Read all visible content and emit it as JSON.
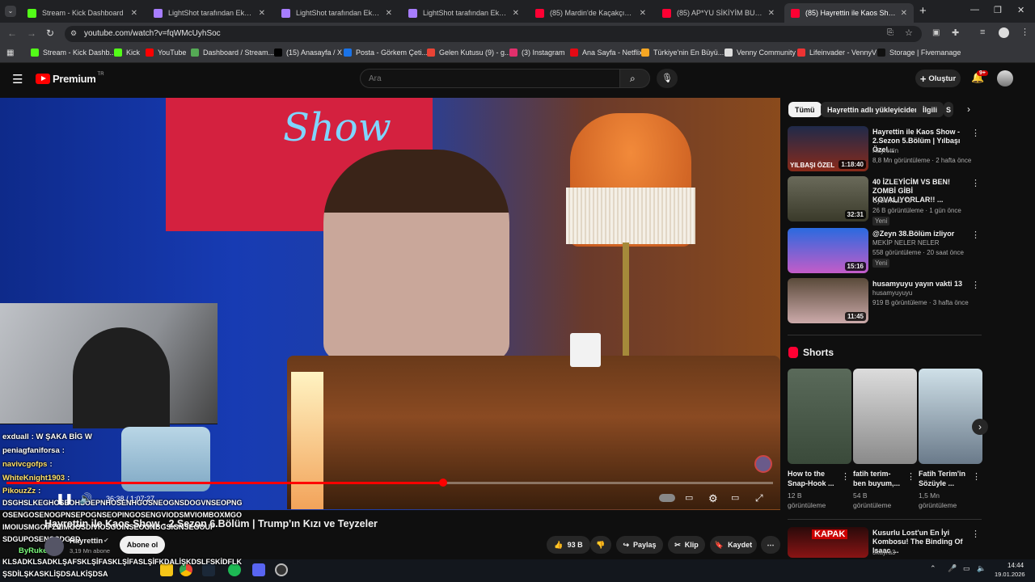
{
  "browser": {
    "tabs": [
      {
        "title": "Stream - Kick Dashboard",
        "color": "#53fc18"
      },
      {
        "title": "LightShot tarafından Ekran Gör",
        "color": "#a77dff"
      },
      {
        "title": "LightShot tarafından Ekran Gör",
        "color": "#a77dff"
      },
      {
        "title": "LightShot tarafından Ekran Gör",
        "color": "#a77dff"
      },
      {
        "title": "(85) Mardin'de Kaçakçıdan 3 D",
        "color": "#ff0033"
      },
      {
        "title": "(85) AP*YU SİKİYİM BU NASIL S",
        "color": "#ff0033"
      },
      {
        "title": "(85) Hayrettin ile Kaos Show",
        "color": "#ff0033"
      }
    ],
    "url": "youtube.com/watch?v=fqWMcUyhSoc",
    "bookmarks": [
      "Stream - Kick Dashb...",
      "Kick",
      "YouTube",
      "Dashboard / Stream...",
      "(15) Anasayfa / X",
      "Posta - Görkem Çeti...",
      "Gelen Kutusu (9) - g...",
      "(3) Instagram",
      "Ana Sayfa - Netflix",
      "Türkiye'nin En Büyü...",
      "Venny Community",
      "Lifeinvader - VennyV",
      "Storage | Fivemanage"
    ]
  },
  "youtube": {
    "logo": "Premium",
    "region": "TR",
    "search_placeholder": "Ara",
    "create_label": "Oluştur",
    "notif_count": "9+",
    "player": {
      "time": "36:38 / 1:07:27",
      "progress": 0.57,
      "scene_sign": "Show"
    },
    "video_title": "Hayrettin ile Kaos Show - 2.Sezon 6.Bölüm | Trump'ın Kızı ve Teyzeler",
    "channel": {
      "name": "Hayrettin",
      "subs": "3,19 Mn abone",
      "subscribe": "Abone ol"
    },
    "actions": {
      "likes": "93 B",
      "share": "Paylaş",
      "clip": "Klip",
      "save": "Kaydet"
    },
    "chips": [
      "Tümü",
      "Hayrettin adlı yükleyiciden",
      "İlgili",
      "S"
    ],
    "recommendations": [
      {
        "title": "Hayrettin ile Kaos Show - 2.Sezon 5.Bölüm | Yılbaşı Özel...",
        "channel": "Hayrettin",
        "meta": "8,8 Mn görüntüleme · 2 hafta önce",
        "duration": "1:18:40",
        "thumb_label": "YILBAŞI ÖZEL",
        "badge": ""
      },
      {
        "title": "40 İZLEYİCİM VS BEN! ZOMBİ GİBİ KOVALIYORLAR!! ...",
        "channel": "CyberRulz Tv",
        "meta": "26 B görüntüleme · 1 gün önce",
        "duration": "32:31",
        "thumb_label": "",
        "badge": "Yeni"
      },
      {
        "title": "@Zeyn 38.Bölüm izliyor",
        "channel": "MEKİP NELER NELER",
        "meta": "558 görüntüleme · 20 saat önce",
        "duration": "15:16",
        "thumb_label": "",
        "badge": "Yeni"
      },
      {
        "title": "husamyuyu yayın vakti 13",
        "channel": "husamyuyuyu",
        "meta": "919 B görüntüleme · 3 hafta önce",
        "duration": "11:45",
        "thumb_label": "",
        "badge": ""
      }
    ],
    "shorts_heading": "Shorts",
    "shorts": [
      {
        "title": "How to the Snap-Hook ...",
        "views": "12 B görüntüleme"
      },
      {
        "title": "fatih terim- ben buyum,...",
        "views": "54 B görüntüleme"
      },
      {
        "title": "Fatih Terim'in Sözüyle ...",
        "views": "1,5 Mn görüntüleme"
      }
    ],
    "bottom_reco": {
      "title": "Kusurlu Lost'un En İyi Kombosu! The Binding Of Isaac ...",
      "channel": "3kayra3",
      "thumb_label": "KAPAK"
    }
  },
  "chat": [
    {
      "user": "exduall",
      "msg": ": W ŞAKA BİG W",
      "color": "#ffffff"
    },
    {
      "user": "peniagfaniforsa",
      "msg": ":",
      "color": "#ffffff"
    },
    {
      "user": "navivcgofps",
      "msg": ":",
      "color": "#ffe16b"
    },
    {
      "user": "WhiteKnight1903",
      "msg": ":",
      "color": "#ffe16b"
    },
    {
      "user": "PikouzZz",
      "msg": ":",
      "color": "#ffe16b"
    }
  ],
  "chat_spam": [
    "DSGHSLKEGHOSEOHSOEPNHOSENHGOSNEOGNSDOGVNSEOPNG",
    "OSENGOSENOGPNSEPOGNSEOPINGOSENGVIODSMVIOMBOXMGO",
    "IMOIUSMGOIFZEIMGOSDIVIOSGOINSEOGNBGSIGNSEGOUP",
    "SDGUPOSENGSDGSD"
  ],
  "chat_last": {
    "user": "ByRuke",
    "msg": ":"
  },
  "chat_bottom": [
    "KLSADKLSADKLŞAFSKLŞİFASKLŞİFASLŞİFKDALİŞKDSLFSKİDFLK",
    "ŞSDİLŞKASKLİŞDSALKİŞDSA"
  ],
  "taskbar": {
    "time": "14:44",
    "date": "19.01.2026"
  }
}
